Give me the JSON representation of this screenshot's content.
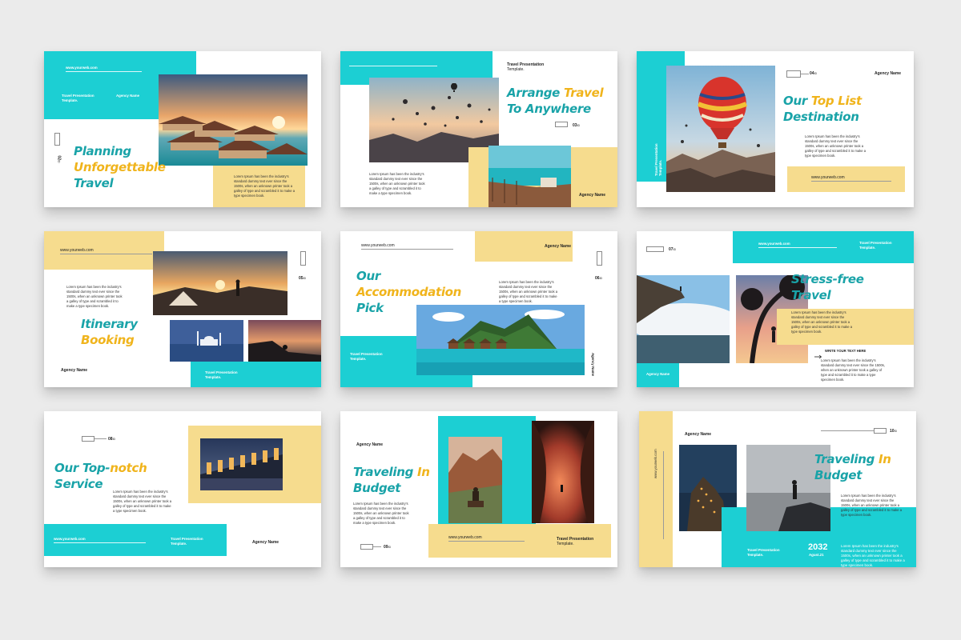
{
  "common": {
    "website": "www.yourweb.com",
    "agency": "Agency Name",
    "template": "Travel Presentation Template.",
    "template_l1": "Travel Presentation",
    "template_l2": "Template.",
    "body": "Lorem Ipsum has been the industry's standard dummy text ever since the 1500s, when an unknown printer took a galley of type and scrambled it to make a type specimen book."
  },
  "slides": [
    {
      "title_a": "Planning",
      "title_b": "Unforgettable",
      "title_c": "Travel",
      "page": "02",
      "page_sub": "ID"
    },
    {
      "title_a": "Arrange ",
      "title_b": "Travel",
      "title_c": "To Anywhere",
      "page": "03",
      "page_sub": "ID"
    },
    {
      "title_a": "Our ",
      "title_b": "Top List",
      "title_c": "Destination",
      "page": "04",
      "page_sub": "ID"
    },
    {
      "title_a": "Itinerary",
      "title_b": "Booking",
      "page": "05",
      "page_sub": "ID"
    },
    {
      "title_a": "Our",
      "title_b": "Accommodation",
      "title_c": "Pick",
      "page": "06",
      "page_sub": "ID"
    },
    {
      "title_a": "Stress-free",
      "title_b": "Travel",
      "page": "07",
      "page_sub": "ID",
      "subhead": "WRITE YOUR TEXT HERE"
    },
    {
      "title_a": "Our Top-",
      "title_b": "notch",
      "title_c": "Service",
      "page": "08",
      "page_sub": "ID"
    },
    {
      "title_a": "Traveling ",
      "title_b": "In",
      "title_c": "Budget",
      "page": "09",
      "page_sub": "ID"
    },
    {
      "title_a": "Traveling ",
      "title_b": "In",
      "title_c": "Budget",
      "page": "10",
      "page_sub": "ID",
      "year": "2032",
      "date": "Agust.21"
    }
  ],
  "colors": {
    "teal": "#1ccfd3",
    "yellow": "#f6dc8e",
    "title_teal": "#19a3a8",
    "title_yellow": "#f0b41c",
    "background": "#ebebeb"
  }
}
